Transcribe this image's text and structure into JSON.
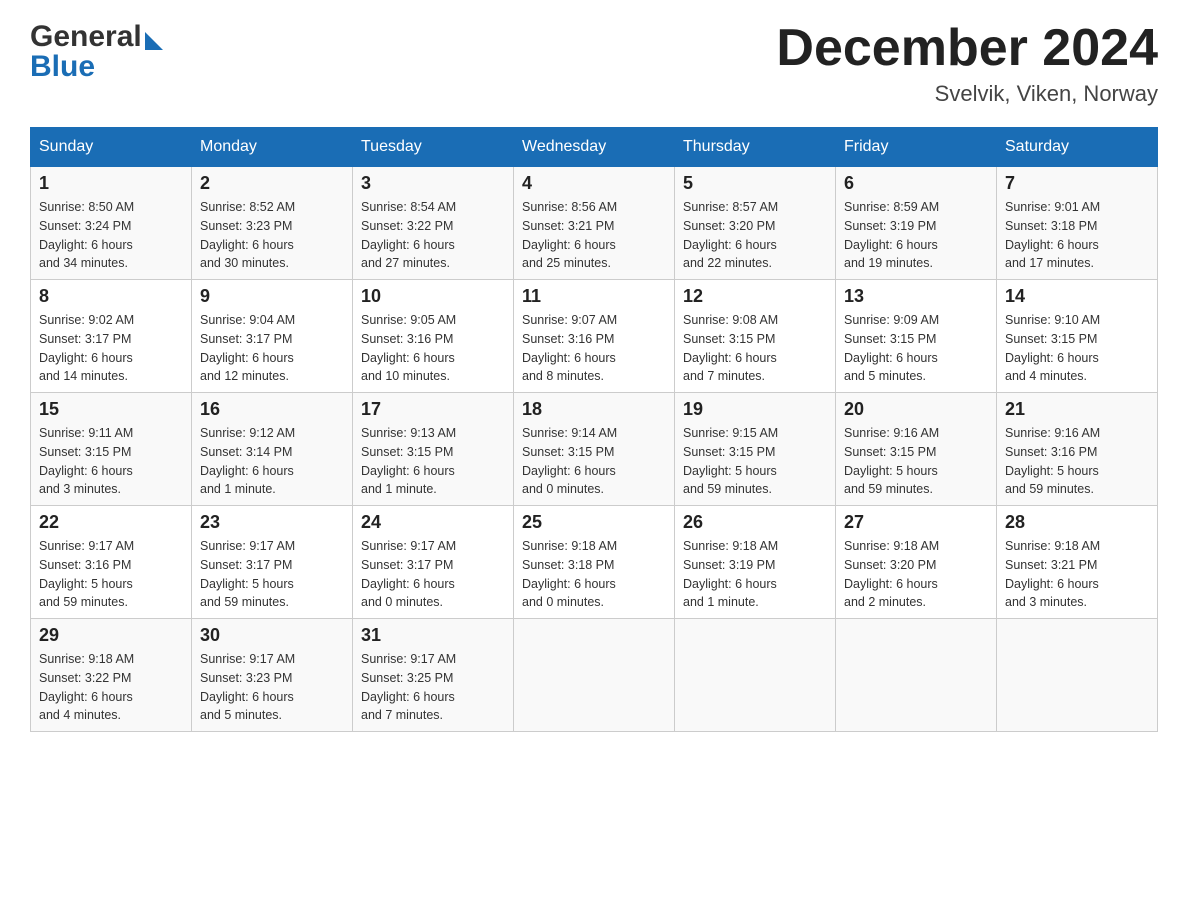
{
  "header": {
    "logo_general": "General",
    "logo_blue": "Blue",
    "month_title": "December 2024",
    "subtitle": "Svelvik, Viken, Norway"
  },
  "days_of_week": [
    "Sunday",
    "Monday",
    "Tuesday",
    "Wednesday",
    "Thursday",
    "Friday",
    "Saturday"
  ],
  "weeks": [
    [
      {
        "day": "1",
        "sunrise": "Sunrise: 8:50 AM",
        "sunset": "Sunset: 3:24 PM",
        "daylight": "Daylight: 6 hours",
        "daylight2": "and 34 minutes."
      },
      {
        "day": "2",
        "sunrise": "Sunrise: 8:52 AM",
        "sunset": "Sunset: 3:23 PM",
        "daylight": "Daylight: 6 hours",
        "daylight2": "and 30 minutes."
      },
      {
        "day": "3",
        "sunrise": "Sunrise: 8:54 AM",
        "sunset": "Sunset: 3:22 PM",
        "daylight": "Daylight: 6 hours",
        "daylight2": "and 27 minutes."
      },
      {
        "day": "4",
        "sunrise": "Sunrise: 8:56 AM",
        "sunset": "Sunset: 3:21 PM",
        "daylight": "Daylight: 6 hours",
        "daylight2": "and 25 minutes."
      },
      {
        "day": "5",
        "sunrise": "Sunrise: 8:57 AM",
        "sunset": "Sunset: 3:20 PM",
        "daylight": "Daylight: 6 hours",
        "daylight2": "and 22 minutes."
      },
      {
        "day": "6",
        "sunrise": "Sunrise: 8:59 AM",
        "sunset": "Sunset: 3:19 PM",
        "daylight": "Daylight: 6 hours",
        "daylight2": "and 19 minutes."
      },
      {
        "day": "7",
        "sunrise": "Sunrise: 9:01 AM",
        "sunset": "Sunset: 3:18 PM",
        "daylight": "Daylight: 6 hours",
        "daylight2": "and 17 minutes."
      }
    ],
    [
      {
        "day": "8",
        "sunrise": "Sunrise: 9:02 AM",
        "sunset": "Sunset: 3:17 PM",
        "daylight": "Daylight: 6 hours",
        "daylight2": "and 14 minutes."
      },
      {
        "day": "9",
        "sunrise": "Sunrise: 9:04 AM",
        "sunset": "Sunset: 3:17 PM",
        "daylight": "Daylight: 6 hours",
        "daylight2": "and 12 minutes."
      },
      {
        "day": "10",
        "sunrise": "Sunrise: 9:05 AM",
        "sunset": "Sunset: 3:16 PM",
        "daylight": "Daylight: 6 hours",
        "daylight2": "and 10 minutes."
      },
      {
        "day": "11",
        "sunrise": "Sunrise: 9:07 AM",
        "sunset": "Sunset: 3:16 PM",
        "daylight": "Daylight: 6 hours",
        "daylight2": "and 8 minutes."
      },
      {
        "day": "12",
        "sunrise": "Sunrise: 9:08 AM",
        "sunset": "Sunset: 3:15 PM",
        "daylight": "Daylight: 6 hours",
        "daylight2": "and 7 minutes."
      },
      {
        "day": "13",
        "sunrise": "Sunrise: 9:09 AM",
        "sunset": "Sunset: 3:15 PM",
        "daylight": "Daylight: 6 hours",
        "daylight2": "and 5 minutes."
      },
      {
        "day": "14",
        "sunrise": "Sunrise: 9:10 AM",
        "sunset": "Sunset: 3:15 PM",
        "daylight": "Daylight: 6 hours",
        "daylight2": "and 4 minutes."
      }
    ],
    [
      {
        "day": "15",
        "sunrise": "Sunrise: 9:11 AM",
        "sunset": "Sunset: 3:15 PM",
        "daylight": "Daylight: 6 hours",
        "daylight2": "and 3 minutes."
      },
      {
        "day": "16",
        "sunrise": "Sunrise: 9:12 AM",
        "sunset": "Sunset: 3:14 PM",
        "daylight": "Daylight: 6 hours",
        "daylight2": "and 1 minute."
      },
      {
        "day": "17",
        "sunrise": "Sunrise: 9:13 AM",
        "sunset": "Sunset: 3:15 PM",
        "daylight": "Daylight: 6 hours",
        "daylight2": "and 1 minute."
      },
      {
        "day": "18",
        "sunrise": "Sunrise: 9:14 AM",
        "sunset": "Sunset: 3:15 PM",
        "daylight": "Daylight: 6 hours",
        "daylight2": "and 0 minutes."
      },
      {
        "day": "19",
        "sunrise": "Sunrise: 9:15 AM",
        "sunset": "Sunset: 3:15 PM",
        "daylight": "Daylight: 5 hours",
        "daylight2": "and 59 minutes."
      },
      {
        "day": "20",
        "sunrise": "Sunrise: 9:16 AM",
        "sunset": "Sunset: 3:15 PM",
        "daylight": "Daylight: 5 hours",
        "daylight2": "and 59 minutes."
      },
      {
        "day": "21",
        "sunrise": "Sunrise: 9:16 AM",
        "sunset": "Sunset: 3:16 PM",
        "daylight": "Daylight: 5 hours",
        "daylight2": "and 59 minutes."
      }
    ],
    [
      {
        "day": "22",
        "sunrise": "Sunrise: 9:17 AM",
        "sunset": "Sunset: 3:16 PM",
        "daylight": "Daylight: 5 hours",
        "daylight2": "and 59 minutes."
      },
      {
        "day": "23",
        "sunrise": "Sunrise: 9:17 AM",
        "sunset": "Sunset: 3:17 PM",
        "daylight": "Daylight: 5 hours",
        "daylight2": "and 59 minutes."
      },
      {
        "day": "24",
        "sunrise": "Sunrise: 9:17 AM",
        "sunset": "Sunset: 3:17 PM",
        "daylight": "Daylight: 6 hours",
        "daylight2": "and 0 minutes."
      },
      {
        "day": "25",
        "sunrise": "Sunrise: 9:18 AM",
        "sunset": "Sunset: 3:18 PM",
        "daylight": "Daylight: 6 hours",
        "daylight2": "and 0 minutes."
      },
      {
        "day": "26",
        "sunrise": "Sunrise: 9:18 AM",
        "sunset": "Sunset: 3:19 PM",
        "daylight": "Daylight: 6 hours",
        "daylight2": "and 1 minute."
      },
      {
        "day": "27",
        "sunrise": "Sunrise: 9:18 AM",
        "sunset": "Sunset: 3:20 PM",
        "daylight": "Daylight: 6 hours",
        "daylight2": "and 2 minutes."
      },
      {
        "day": "28",
        "sunrise": "Sunrise: 9:18 AM",
        "sunset": "Sunset: 3:21 PM",
        "daylight": "Daylight: 6 hours",
        "daylight2": "and 3 minutes."
      }
    ],
    [
      {
        "day": "29",
        "sunrise": "Sunrise: 9:18 AM",
        "sunset": "Sunset: 3:22 PM",
        "daylight": "Daylight: 6 hours",
        "daylight2": "and 4 minutes."
      },
      {
        "day": "30",
        "sunrise": "Sunrise: 9:17 AM",
        "sunset": "Sunset: 3:23 PM",
        "daylight": "Daylight: 6 hours",
        "daylight2": "and 5 minutes."
      },
      {
        "day": "31",
        "sunrise": "Sunrise: 9:17 AM",
        "sunset": "Sunset: 3:25 PM",
        "daylight": "Daylight: 6 hours",
        "daylight2": "and 7 minutes."
      },
      null,
      null,
      null,
      null
    ]
  ]
}
